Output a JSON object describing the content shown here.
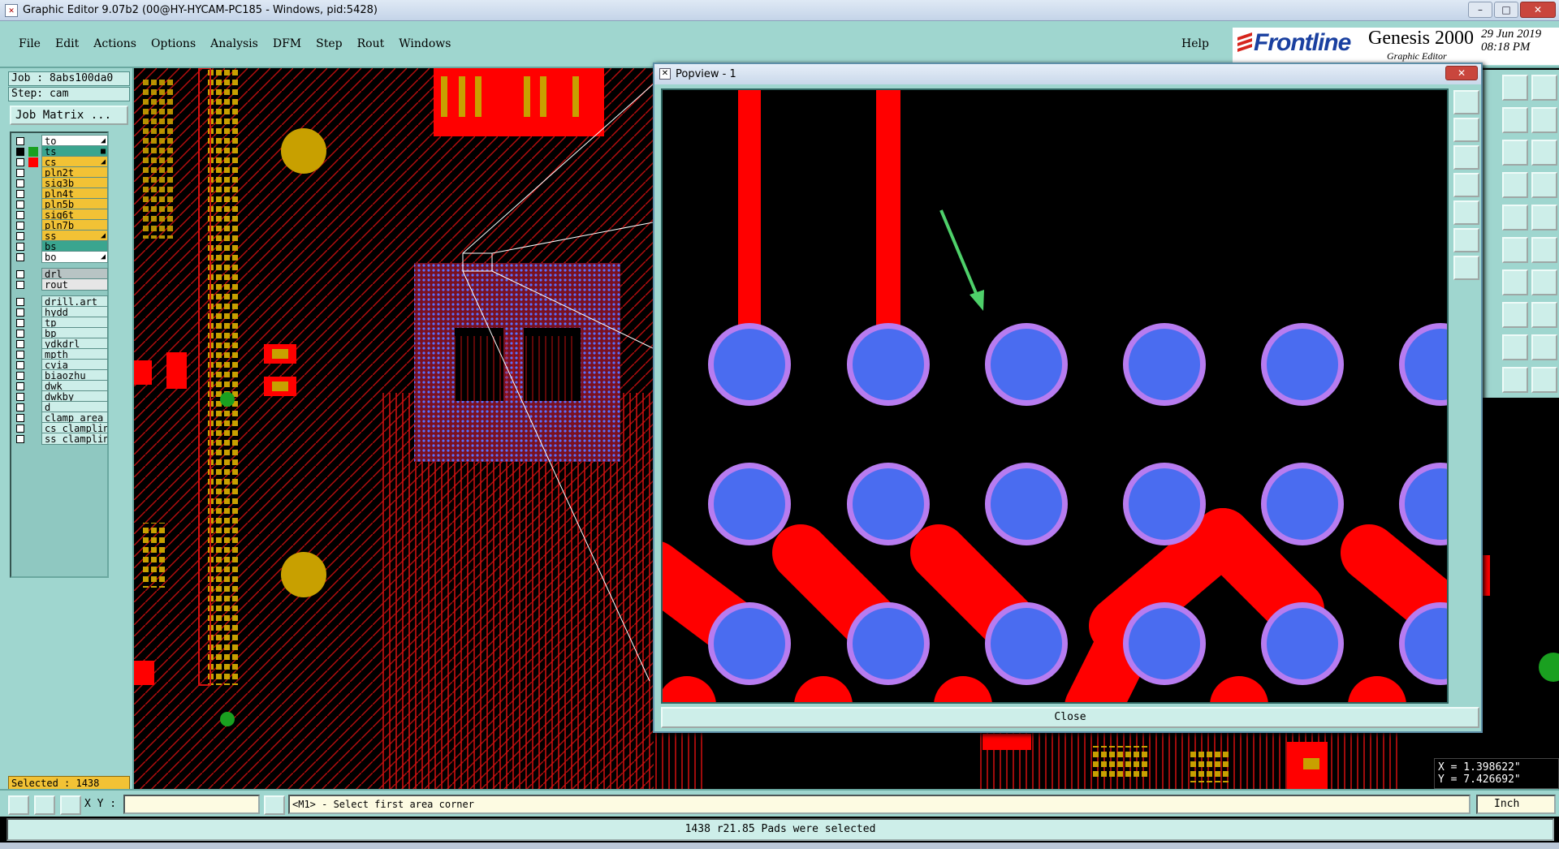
{
  "window": {
    "title": "Graphic Editor 9.07b2 (00@HY-HYCAM-PC185 - Windows, pid:5428)",
    "controls": {
      "minimize": "–",
      "maximize": "□",
      "close": "✕"
    }
  },
  "menu": {
    "items": [
      "File",
      "Edit",
      "Actions",
      "Options",
      "Analysis",
      "DFM",
      "Step",
      "Rout",
      "Windows"
    ],
    "help": "Help"
  },
  "brand": {
    "logo": "Frontline",
    "product": "Genesis 2000",
    "subtitle": "Graphic Editor",
    "date": "29 Jun 2019",
    "time": "08:18 PM"
  },
  "job": {
    "job_label": "Job : 8abs100da0",
    "step_label": "Step: cam",
    "matrix_button": "Job Matrix ..."
  },
  "layers": [
    {
      "name": "to",
      "color": "#ffffff",
      "checked": false,
      "marker": "◢"
    },
    {
      "name": "ts",
      "color": "#3aa58f",
      "checked": true,
      "marker": "■"
    },
    {
      "name": "cs",
      "color": "#f2c235",
      "checked": false,
      "marker": "◢"
    },
    {
      "name": "pln2t",
      "color": "#f2c235",
      "checked": false,
      "marker": ""
    },
    {
      "name": "sig3b",
      "color": "#f2c235",
      "checked": false,
      "marker": ""
    },
    {
      "name": "pln4t",
      "color": "#f2c235",
      "checked": false,
      "marker": ""
    },
    {
      "name": "pln5b",
      "color": "#f2c235",
      "checked": false,
      "marker": ""
    },
    {
      "name": "sig6t",
      "color": "#f2c235",
      "checked": false,
      "marker": ""
    },
    {
      "name": "pln7b",
      "color": "#f2c235",
      "checked": false,
      "marker": ""
    },
    {
      "name": "ss",
      "color": "#f2c235",
      "checked": false,
      "marker": "◢"
    },
    {
      "name": "bs",
      "color": "#3aa58f",
      "checked": false,
      "marker": ""
    },
    {
      "name": "bo",
      "color": "#ffffff",
      "checked": false,
      "marker": "◢"
    },
    {
      "name": "drl",
      "color": "#b8c4c4",
      "checked": false,
      "marker": ""
    },
    {
      "name": "rout",
      "color": "#e6e6e6",
      "checked": false,
      "marker": ""
    },
    {
      "name": "drill.art",
      "color": "#cdeee9",
      "checked": false,
      "marker": ""
    },
    {
      "name": "hydd",
      "color": "#cdeee9",
      "checked": false,
      "marker": ""
    },
    {
      "name": "tp",
      "color": "#cdeee9",
      "checked": false,
      "marker": ""
    },
    {
      "name": "bp",
      "color": "#cdeee9",
      "checked": false,
      "marker": ""
    },
    {
      "name": "ydkdrl",
      "color": "#cdeee9",
      "checked": false,
      "marker": ""
    },
    {
      "name": "mpth",
      "color": "#cdeee9",
      "checked": false,
      "marker": ""
    },
    {
      "name": "cvia",
      "color": "#cdeee9",
      "checked": false,
      "marker": ""
    },
    {
      "name": "biaozhu",
      "color": "#cdeee9",
      "checked": false,
      "marker": ""
    },
    {
      "name": "dwk",
      "color": "#cdeee9",
      "checked": false,
      "marker": ""
    },
    {
      "name": "dwkby",
      "color": "#cdeee9",
      "checked": false,
      "marker": ""
    },
    {
      "name": "d",
      "color": "#cdeee9",
      "checked": false,
      "marker": ""
    },
    {
      "name": "clamp_area",
      "color": "#cdeee9",
      "checked": false,
      "marker": ""
    },
    {
      "name": "cs_clampline",
      "color": "#cdeee9",
      "checked": false,
      "marker": ""
    },
    {
      "name": "ss_clampline",
      "color": "#cdeee9",
      "checked": false,
      "marker": ""
    }
  ],
  "selected_label": "Selected : 1438",
  "popview": {
    "title": "Popview - 1",
    "close_button": "Close",
    "close_x": "✕"
  },
  "coords": {
    "x": "X = 1.398622\"",
    "y": "Y = 7.426692\""
  },
  "command": {
    "xy_label": "X Y :",
    "xy_value": "",
    "prompt": "<M1> - Select first area corner",
    "units": "Inch"
  },
  "status": "1438 r21.85 Pads were selected",
  "colors": {
    "panel": "#9fd6cf",
    "field": "#cdeee9",
    "trace": "#ff0000",
    "pad_fill": "#4a6cf0",
    "pad_ring": "#b77cf0",
    "gold": "#c8a000",
    "highlight": "#f2c235"
  }
}
